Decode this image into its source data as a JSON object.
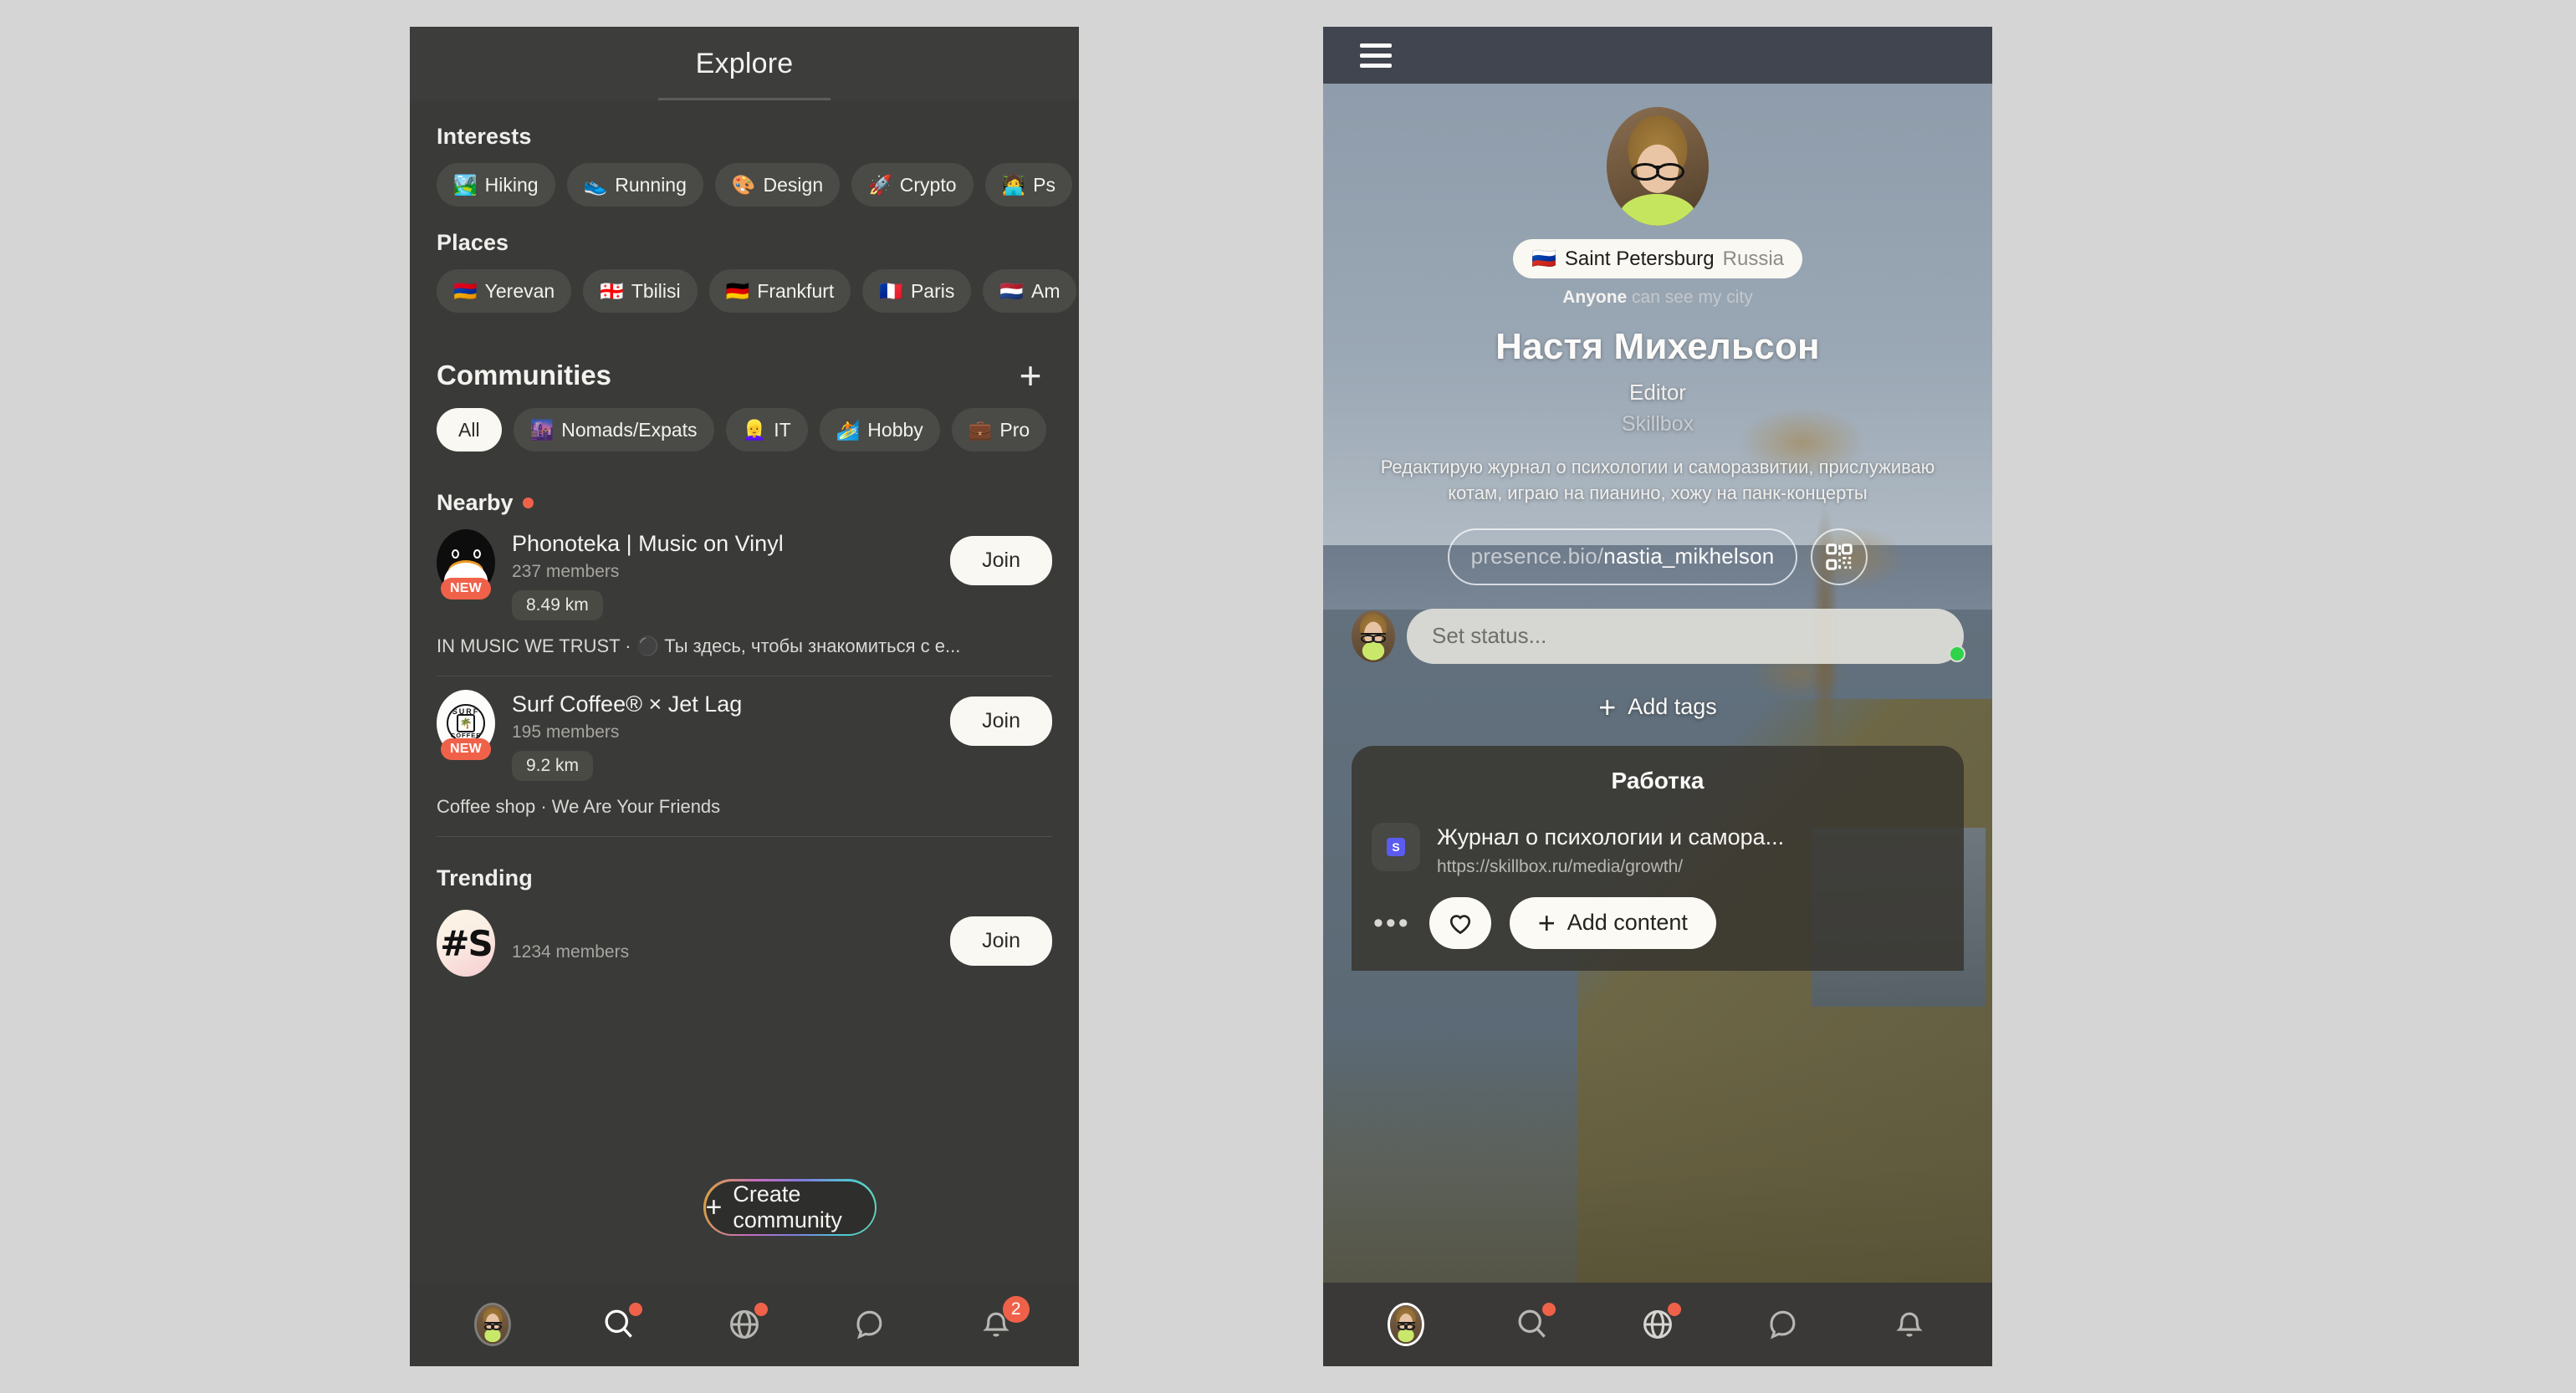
{
  "left": {
    "header": {
      "title": "Explore"
    },
    "interests": {
      "label": "Interests",
      "chips": [
        {
          "emoji": "🏞️",
          "label": "Hiking"
        },
        {
          "emoji": "👟",
          "label": "Running"
        },
        {
          "emoji": "🎨",
          "label": "Design"
        },
        {
          "emoji": "🚀",
          "label": "Crypto"
        },
        {
          "emoji": "🧑‍💻",
          "label": "Ps"
        }
      ]
    },
    "places": {
      "label": "Places",
      "chips": [
        {
          "emoji": "🇦🇲",
          "label": "Yerevan"
        },
        {
          "emoji": "🇬🇪",
          "label": "Tbilisi"
        },
        {
          "emoji": "🇩🇪",
          "label": "Frankfurt"
        },
        {
          "emoji": "🇫🇷",
          "label": "Paris"
        },
        {
          "emoji": "🇳🇱",
          "label": "Am"
        }
      ]
    },
    "communities": {
      "label": "Communities",
      "add_icon": "+",
      "filters": [
        {
          "emoji": "",
          "label": "All",
          "selected": true
        },
        {
          "emoji": "🌆",
          "label": "Nomads/Expats",
          "selected": false
        },
        {
          "emoji": "👱‍♀️",
          "label": "IT",
          "selected": false
        },
        {
          "emoji": "🏄",
          "label": "Hobby",
          "selected": false
        },
        {
          "emoji": "💼",
          "label": "Pro",
          "selected": false
        }
      ]
    },
    "nearby": {
      "label": "Nearby",
      "items": [
        {
          "title": "Phonoteka | Music on Vinyl",
          "members": "237 members",
          "distance": "8.49 km",
          "badge": "NEW",
          "join_label": "Join",
          "description": "IN MUSIC WE TRUST · ⚫ Ты здесь, чтобы знакомиться с е..."
        },
        {
          "title": "Surf Coffee® × Jet Lag",
          "members": "195 members",
          "distance": "9.2 km",
          "badge": "NEW",
          "join_label": "Join",
          "description": "Coffee shop · We Are Your Friends"
        }
      ]
    },
    "trending": {
      "label": "Trending",
      "items": [
        {
          "avatar_text": "#S",
          "members": "1234 members",
          "join_label": "Join"
        }
      ]
    },
    "create_pill": {
      "icon": "+",
      "label": "Create community"
    },
    "bottom_nav": [
      {
        "icon": "avatar-icon",
        "badge": "",
        "active": false
      },
      {
        "icon": "search-icon",
        "badge": "dot",
        "active": true
      },
      {
        "icon": "globe-icon",
        "badge": "dot",
        "active": false
      },
      {
        "icon": "chat-bubble-icon",
        "badge": "",
        "active": false
      },
      {
        "icon": "bell-icon",
        "badge": "2",
        "active": false
      }
    ]
  },
  "right": {
    "header": {
      "menu_icon": "hamburger-icon"
    },
    "profile": {
      "location_flag": "🇷🇺",
      "location_city": "Saint Petersburg",
      "location_country": "Russia",
      "privacy_strong": "Anyone",
      "privacy_rest": " can see my city",
      "name": "Настя Михельсон",
      "role": "Editor",
      "company": "Skillbox",
      "bio": "Редактирую журнал о психологии и саморазвитии, прислуживаю котам, играю на пианино, хожу на панк-концерты",
      "link_domain": "presence.bio/",
      "link_handle": "nastia_mikhelson",
      "qr_icon": "qr-code-icon"
    },
    "status": {
      "placeholder": "Set status...",
      "presence": "online"
    },
    "add_tags": {
      "icon": "+",
      "label": "Add tags"
    },
    "work_card": {
      "title": "Работка",
      "item": {
        "favicon_letter": "S",
        "name": "Журнал о психологии и самора...",
        "url": "https://skillbox.ru/media/growth/"
      },
      "more_icon": "•••",
      "like_icon": "heart-icon",
      "add_content": {
        "icon": "+",
        "label": "Add content"
      }
    },
    "bottom_nav": [
      {
        "icon": "avatar-icon",
        "badge": "",
        "active": true
      },
      {
        "icon": "search-icon",
        "badge": "dot",
        "active": false
      },
      {
        "icon": "globe-icon",
        "badge": "dot",
        "active": false
      },
      {
        "icon": "chat-bubble-icon",
        "badge": "",
        "active": false
      },
      {
        "icon": "bell-icon",
        "badge": "",
        "active": false
      }
    ]
  },
  "colors": {
    "accent_red": "#f0614a",
    "surface_dark": "#3a3a38",
    "chip_bg": "#4a4a47",
    "button_light": "#faf8f2",
    "header_right": "#40454f",
    "online_green": "#2fd34a"
  }
}
